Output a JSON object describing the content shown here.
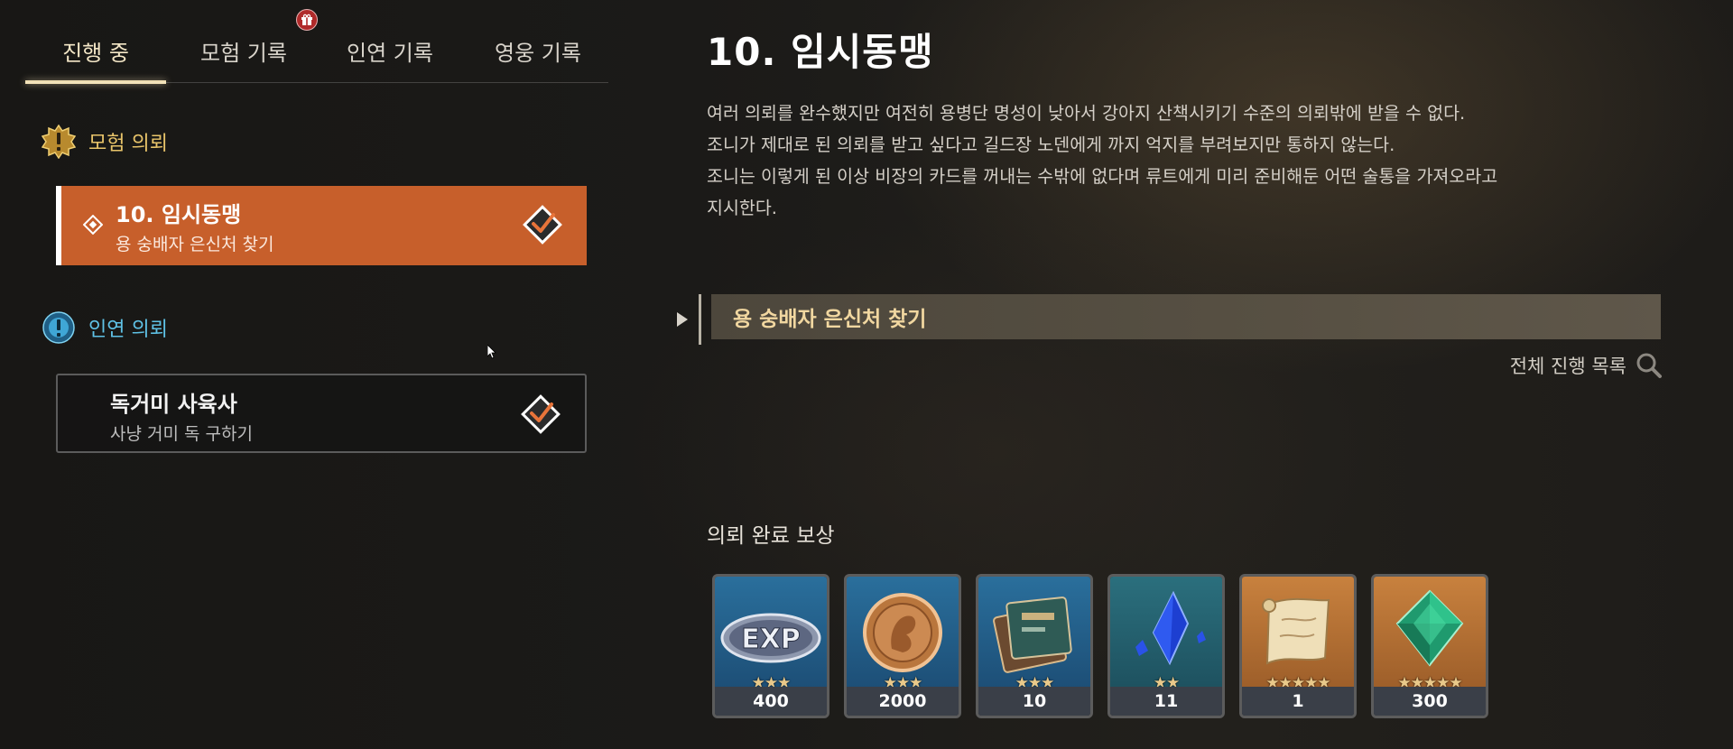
{
  "tabs": [
    {
      "label": "진행 중",
      "active": true
    },
    {
      "label": "모험 기록",
      "active": false,
      "badge": "gift-icon"
    },
    {
      "label": "인연 기록",
      "active": false
    },
    {
      "label": "영웅 기록",
      "active": false
    }
  ],
  "sections": {
    "adventure": {
      "label": "모험 의뢰",
      "color": "#e8c46a"
    },
    "bond": {
      "label": "인연 의뢰",
      "color": "#5fc2e6"
    }
  },
  "quests": [
    {
      "title": "10. 임시동맹",
      "subtitle": "용 숭배자 은신처 찾기",
      "selected": true,
      "status_icon": "checkmark-icon"
    },
    {
      "title": "독거미 사육사",
      "subtitle": "사냥 거미 독 구하기",
      "selected": false,
      "status_icon": "checkmark-icon"
    }
  ],
  "detail": {
    "title": "10. 임시동맹",
    "description": [
      "여러 의뢰를 완수했지만 여전히 용병단 명성이 낮아서 강아지 산책시키기 수준의 의뢰밖에 받을 수 없다.",
      "조니가 제대로 된 의뢰를 받고 싶다고 길드장 노덴에게 까지 억지를 부려보지만 통하지 않는다.",
      "조니는 이렇게 된 이상 비장의 카드를 꺼내는 수밖에 없다며 류트에게 미리 준비해둔 어떤 술통을 가져오라고",
      "지시한다."
    ],
    "objective": "용 숭배자 은신처 찾기",
    "full_list_label": "전체 진행 목록",
    "rewards_heading": "의뢰 완료 보상"
  },
  "rewards": [
    {
      "icon": "exp-icon",
      "stars": 3,
      "count": "400",
      "bg": "blue"
    },
    {
      "icon": "coin-icon",
      "stars": 3,
      "count": "2000",
      "bg": "blue"
    },
    {
      "icon": "book-icon",
      "stars": 3,
      "count": "10",
      "bg": "blue"
    },
    {
      "icon": "blue-crystal-icon",
      "stars": 2,
      "count": "11",
      "bg": "teal"
    },
    {
      "icon": "scroll-icon",
      "stars": 5,
      "count": "1",
      "bg": "orange"
    },
    {
      "icon": "green-gem-icon",
      "stars": 5,
      "count": "300",
      "bg": "orange"
    }
  ],
  "colors": {
    "accent": "#c75f2b",
    "tab_active": "#f0dfb3",
    "objective_text": "#f1d7a0"
  }
}
